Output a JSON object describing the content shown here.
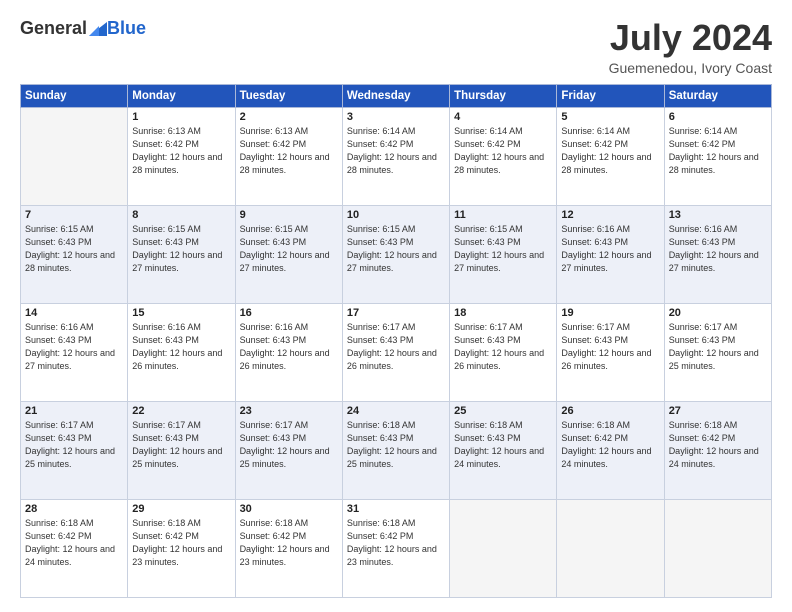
{
  "header": {
    "logo_general": "General",
    "logo_blue": "Blue",
    "title": "July 2024",
    "subtitle": "Guemenedou, Ivory Coast"
  },
  "days_of_week": [
    "Sunday",
    "Monday",
    "Tuesday",
    "Wednesday",
    "Thursday",
    "Friday",
    "Saturday"
  ],
  "weeks": [
    [
      {
        "day": "",
        "empty": true
      },
      {
        "day": "1",
        "sunrise": "Sunrise: 6:13 AM",
        "sunset": "Sunset: 6:42 PM",
        "daylight": "Daylight: 12 hours and 28 minutes."
      },
      {
        "day": "2",
        "sunrise": "Sunrise: 6:13 AM",
        "sunset": "Sunset: 6:42 PM",
        "daylight": "Daylight: 12 hours and 28 minutes."
      },
      {
        "day": "3",
        "sunrise": "Sunrise: 6:14 AM",
        "sunset": "Sunset: 6:42 PM",
        "daylight": "Daylight: 12 hours and 28 minutes."
      },
      {
        "day": "4",
        "sunrise": "Sunrise: 6:14 AM",
        "sunset": "Sunset: 6:42 PM",
        "daylight": "Daylight: 12 hours and 28 minutes."
      },
      {
        "day": "5",
        "sunrise": "Sunrise: 6:14 AM",
        "sunset": "Sunset: 6:42 PM",
        "daylight": "Daylight: 12 hours and 28 minutes."
      },
      {
        "day": "6",
        "sunrise": "Sunrise: 6:14 AM",
        "sunset": "Sunset: 6:42 PM",
        "daylight": "Daylight: 12 hours and 28 minutes."
      }
    ],
    [
      {
        "day": "7",
        "sunrise": "Sunrise: 6:15 AM",
        "sunset": "Sunset: 6:43 PM",
        "daylight": "Daylight: 12 hours and 28 minutes."
      },
      {
        "day": "8",
        "sunrise": "Sunrise: 6:15 AM",
        "sunset": "Sunset: 6:43 PM",
        "daylight": "Daylight: 12 hours and 27 minutes."
      },
      {
        "day": "9",
        "sunrise": "Sunrise: 6:15 AM",
        "sunset": "Sunset: 6:43 PM",
        "daylight": "Daylight: 12 hours and 27 minutes."
      },
      {
        "day": "10",
        "sunrise": "Sunrise: 6:15 AM",
        "sunset": "Sunset: 6:43 PM",
        "daylight": "Daylight: 12 hours and 27 minutes."
      },
      {
        "day": "11",
        "sunrise": "Sunrise: 6:15 AM",
        "sunset": "Sunset: 6:43 PM",
        "daylight": "Daylight: 12 hours and 27 minutes."
      },
      {
        "day": "12",
        "sunrise": "Sunrise: 6:16 AM",
        "sunset": "Sunset: 6:43 PM",
        "daylight": "Daylight: 12 hours and 27 minutes."
      },
      {
        "day": "13",
        "sunrise": "Sunrise: 6:16 AM",
        "sunset": "Sunset: 6:43 PM",
        "daylight": "Daylight: 12 hours and 27 minutes."
      }
    ],
    [
      {
        "day": "14",
        "sunrise": "Sunrise: 6:16 AM",
        "sunset": "Sunset: 6:43 PM",
        "daylight": "Daylight: 12 hours and 27 minutes."
      },
      {
        "day": "15",
        "sunrise": "Sunrise: 6:16 AM",
        "sunset": "Sunset: 6:43 PM",
        "daylight": "Daylight: 12 hours and 26 minutes."
      },
      {
        "day": "16",
        "sunrise": "Sunrise: 6:16 AM",
        "sunset": "Sunset: 6:43 PM",
        "daylight": "Daylight: 12 hours and 26 minutes."
      },
      {
        "day": "17",
        "sunrise": "Sunrise: 6:17 AM",
        "sunset": "Sunset: 6:43 PM",
        "daylight": "Daylight: 12 hours and 26 minutes."
      },
      {
        "day": "18",
        "sunrise": "Sunrise: 6:17 AM",
        "sunset": "Sunset: 6:43 PM",
        "daylight": "Daylight: 12 hours and 26 minutes."
      },
      {
        "day": "19",
        "sunrise": "Sunrise: 6:17 AM",
        "sunset": "Sunset: 6:43 PM",
        "daylight": "Daylight: 12 hours and 26 minutes."
      },
      {
        "day": "20",
        "sunrise": "Sunrise: 6:17 AM",
        "sunset": "Sunset: 6:43 PM",
        "daylight": "Daylight: 12 hours and 25 minutes."
      }
    ],
    [
      {
        "day": "21",
        "sunrise": "Sunrise: 6:17 AM",
        "sunset": "Sunset: 6:43 PM",
        "daylight": "Daylight: 12 hours and 25 minutes."
      },
      {
        "day": "22",
        "sunrise": "Sunrise: 6:17 AM",
        "sunset": "Sunset: 6:43 PM",
        "daylight": "Daylight: 12 hours and 25 minutes."
      },
      {
        "day": "23",
        "sunrise": "Sunrise: 6:17 AM",
        "sunset": "Sunset: 6:43 PM",
        "daylight": "Daylight: 12 hours and 25 minutes."
      },
      {
        "day": "24",
        "sunrise": "Sunrise: 6:18 AM",
        "sunset": "Sunset: 6:43 PM",
        "daylight": "Daylight: 12 hours and 25 minutes."
      },
      {
        "day": "25",
        "sunrise": "Sunrise: 6:18 AM",
        "sunset": "Sunset: 6:43 PM",
        "daylight": "Daylight: 12 hours and 24 minutes."
      },
      {
        "day": "26",
        "sunrise": "Sunrise: 6:18 AM",
        "sunset": "Sunset: 6:42 PM",
        "daylight": "Daylight: 12 hours and 24 minutes."
      },
      {
        "day": "27",
        "sunrise": "Sunrise: 6:18 AM",
        "sunset": "Sunset: 6:42 PM",
        "daylight": "Daylight: 12 hours and 24 minutes."
      }
    ],
    [
      {
        "day": "28",
        "sunrise": "Sunrise: 6:18 AM",
        "sunset": "Sunset: 6:42 PM",
        "daylight": "Daylight: 12 hours and 24 minutes."
      },
      {
        "day": "29",
        "sunrise": "Sunrise: 6:18 AM",
        "sunset": "Sunset: 6:42 PM",
        "daylight": "Daylight: 12 hours and 23 minutes."
      },
      {
        "day": "30",
        "sunrise": "Sunrise: 6:18 AM",
        "sunset": "Sunset: 6:42 PM",
        "daylight": "Daylight: 12 hours and 23 minutes."
      },
      {
        "day": "31",
        "sunrise": "Sunrise: 6:18 AM",
        "sunset": "Sunset: 6:42 PM",
        "daylight": "Daylight: 12 hours and 23 minutes."
      },
      {
        "day": "",
        "empty": true
      },
      {
        "day": "",
        "empty": true
      },
      {
        "day": "",
        "empty": true
      }
    ]
  ]
}
